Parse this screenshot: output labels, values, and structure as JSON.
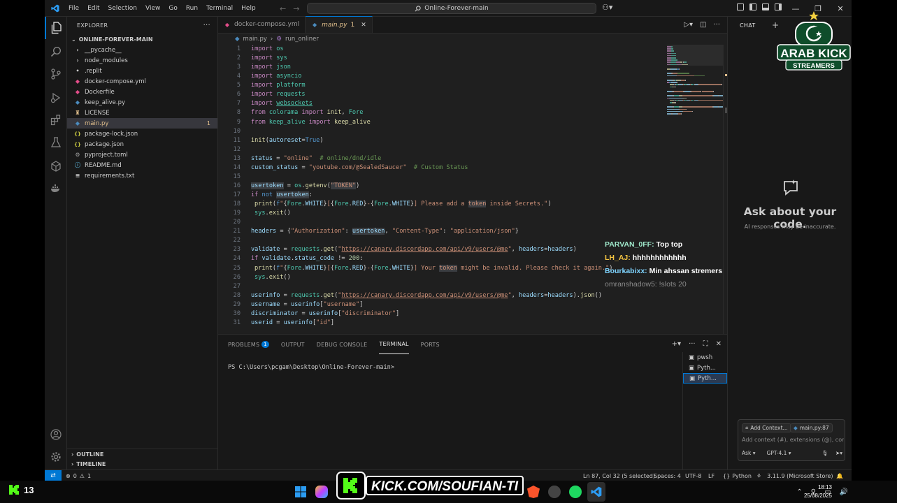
{
  "titlebar": {
    "menus": [
      "File",
      "Edit",
      "Selection",
      "View",
      "Go",
      "Run",
      "Terminal",
      "Help"
    ],
    "search": "Online-Forever-main"
  },
  "explorer": {
    "header": "EXPLORER",
    "folder": "ONLINE-FOREVER-MAIN",
    "items": [
      {
        "name": "__pycache__",
        "type": "folder"
      },
      {
        "name": "node_modules",
        "type": "folder"
      },
      {
        "name": ".replit",
        "type": "file"
      },
      {
        "name": "docker-compose.yml",
        "type": "docker"
      },
      {
        "name": "Dockerfile",
        "type": "docker"
      },
      {
        "name": "keep_alive.py",
        "type": "python"
      },
      {
        "name": "LICENSE",
        "type": "license"
      },
      {
        "name": "main.py",
        "type": "python",
        "badge": "1"
      },
      {
        "name": "package-lock.json",
        "type": "json"
      },
      {
        "name": "package.json",
        "type": "json"
      },
      {
        "name": "pyproject.toml",
        "type": "gear"
      },
      {
        "name": "README.md",
        "type": "info"
      },
      {
        "name": "requirements.txt",
        "type": "text"
      }
    ],
    "outline": "OUTLINE",
    "timeline": "TIMELINE"
  },
  "editor": {
    "tabs": [
      {
        "label": "docker-compose.yml",
        "active": false
      },
      {
        "label": "main.py",
        "active": true,
        "problems": "1"
      }
    ],
    "breadcrumb": [
      "main.py",
      "run_onliner"
    ]
  },
  "code": [
    {
      "n": "1",
      "t": [
        [
          "k",
          "import "
        ],
        [
          "m",
          "os"
        ]
      ]
    },
    {
      "n": "2",
      "t": [
        [
          "k",
          "import "
        ],
        [
          "m",
          "sys"
        ]
      ]
    },
    {
      "n": "3",
      "t": [
        [
          "k",
          "import "
        ],
        [
          "m",
          "json"
        ]
      ]
    },
    {
      "n": "4",
      "t": [
        [
          "k",
          "import "
        ],
        [
          "m",
          "asyncio"
        ]
      ]
    },
    {
      "n": "5",
      "t": [
        [
          "k",
          "import "
        ],
        [
          "m",
          "platform"
        ]
      ]
    },
    {
      "n": "6",
      "t": [
        [
          "k",
          "import "
        ],
        [
          "m",
          "requests"
        ]
      ]
    },
    {
      "n": "7",
      "t": [
        [
          "k",
          "import "
        ],
        [
          "m ul",
          "websockets"
        ]
      ]
    },
    {
      "n": "8",
      "t": [
        [
          "k",
          "from "
        ],
        [
          "m",
          "colorama "
        ],
        [
          "k",
          "import "
        ],
        [
          "f",
          "init"
        ],
        [
          "o",
          ", "
        ],
        [
          "m",
          "Fore"
        ]
      ]
    },
    {
      "n": "9",
      "t": [
        [
          "k",
          "from "
        ],
        [
          "m",
          "keep_alive "
        ],
        [
          "k",
          "import "
        ],
        [
          "f",
          "keep_alive"
        ]
      ]
    },
    {
      "n": "10",
      "t": []
    },
    {
      "n": "11",
      "t": [
        [
          "f",
          "init"
        ],
        [
          "o",
          "("
        ],
        [
          "v",
          "autoreset"
        ],
        [
          "o",
          "="
        ],
        [
          "bc",
          "True"
        ],
        [
          "o",
          ")"
        ]
      ]
    },
    {
      "n": "12",
      "t": []
    },
    {
      "n": "13",
      "t": [
        [
          "v",
          "status "
        ],
        [
          "o",
          "= "
        ],
        [
          "s",
          "\"online\""
        ],
        [
          "c",
          "  # online/dnd/idle"
        ]
      ]
    },
    {
      "n": "14",
      "t": [
        [
          "v",
          "custom_status "
        ],
        [
          "o",
          "= "
        ],
        [
          "s",
          "\"youtube.com/@SealedSaucer\""
        ],
        [
          "c",
          "  # Custom Status"
        ]
      ]
    },
    {
      "n": "15",
      "t": []
    },
    {
      "n": "16",
      "t": [
        [
          "v hl",
          "usertoken"
        ],
        [
          "o",
          " = "
        ],
        [
          "m",
          "os"
        ],
        [
          "o",
          "."
        ],
        [
          "f",
          "getenv"
        ],
        [
          "o",
          "("
        ],
        [
          "s hl",
          "\"TOKEN\""
        ],
        [
          "o",
          ")"
        ]
      ]
    },
    {
      "n": "17",
      "t": [
        [
          "k",
          "if "
        ],
        [
          "bc",
          "not "
        ],
        [
          "v hl",
          "usertoken"
        ],
        [
          "o",
          ":"
        ]
      ]
    },
    {
      "n": "18",
      "ind": true,
      "t": [
        [
          "f",
          "print"
        ],
        [
          "o",
          "("
        ],
        [
          "bc",
          "f"
        ],
        [
          "s",
          "\""
        ],
        [
          "o",
          "{"
        ],
        [
          "m",
          "Fore"
        ],
        [
          "o",
          "."
        ],
        [
          "v",
          "WHITE"
        ],
        [
          "o",
          "}"
        ],
        [
          "s",
          "["
        ],
        [
          "o",
          "{"
        ],
        [
          "m",
          "Fore"
        ],
        [
          "o",
          "."
        ],
        [
          "v",
          "RED"
        ],
        [
          "o",
          "}"
        ],
        [
          "s",
          "-"
        ],
        [
          "o",
          "{"
        ],
        [
          "m",
          "Fore"
        ],
        [
          "o",
          "."
        ],
        [
          "v",
          "WHITE"
        ],
        [
          "o",
          "}"
        ],
        [
          "s",
          "] Please add a "
        ],
        [
          "s hl",
          "token"
        ],
        [
          "s",
          " inside Secrets.\""
        ],
        [
          "o",
          ")"
        ]
      ]
    },
    {
      "n": "19",
      "ind": true,
      "t": [
        [
          "m",
          "sys"
        ],
        [
          "o",
          "."
        ],
        [
          "f",
          "exit"
        ],
        [
          "o",
          "()"
        ]
      ]
    },
    {
      "n": "20",
      "t": []
    },
    {
      "n": "21",
      "t": [
        [
          "v",
          "headers "
        ],
        [
          "o",
          "= {"
        ],
        [
          "s",
          "\"Authorization\""
        ],
        [
          "o",
          ": "
        ],
        [
          "v hl",
          "usertoken"
        ],
        [
          "o",
          ", "
        ],
        [
          "s",
          "\"Content-Type\""
        ],
        [
          "o",
          ": "
        ],
        [
          "s",
          "\"application/json\""
        ],
        [
          "o",
          "}"
        ]
      ]
    },
    {
      "n": "22",
      "t": []
    },
    {
      "n": "23",
      "t": [
        [
          "v",
          "validate "
        ],
        [
          "o",
          "= "
        ],
        [
          "m",
          "requests"
        ],
        [
          "o",
          "."
        ],
        [
          "f",
          "get"
        ],
        [
          "o",
          "("
        ],
        [
          "s",
          "\""
        ],
        [
          "s ul",
          "https://canary.discordapp.com/api/v9/users/@me"
        ],
        [
          "s",
          "\""
        ],
        [
          "o",
          ", "
        ],
        [
          "v",
          "headers"
        ],
        [
          "o",
          "="
        ],
        [
          "v",
          "headers"
        ],
        [
          "o",
          ")"
        ]
      ]
    },
    {
      "n": "24",
      "t": [
        [
          "k",
          "if "
        ],
        [
          "v",
          "validate"
        ],
        [
          "o",
          "."
        ],
        [
          "v",
          "status_code "
        ],
        [
          "o",
          "!= "
        ],
        [
          "n",
          "200"
        ],
        [
          "o",
          ":"
        ]
      ]
    },
    {
      "n": "25",
      "ind": true,
      "t": [
        [
          "f",
          "print"
        ],
        [
          "o",
          "("
        ],
        [
          "bc",
          "f"
        ],
        [
          "s",
          "\""
        ],
        [
          "o",
          "{"
        ],
        [
          "m",
          "Fore"
        ],
        [
          "o",
          "."
        ],
        [
          "v",
          "WHITE"
        ],
        [
          "o",
          "}"
        ],
        [
          "s",
          "["
        ],
        [
          "o",
          "{"
        ],
        [
          "m",
          "Fore"
        ],
        [
          "o",
          "."
        ],
        [
          "v",
          "RED"
        ],
        [
          "o",
          "}"
        ],
        [
          "s",
          "-"
        ],
        [
          "o",
          "{"
        ],
        [
          "m",
          "Fore"
        ],
        [
          "o",
          "."
        ],
        [
          "v",
          "WHITE"
        ],
        [
          "o",
          "}"
        ],
        [
          "s",
          "] Your "
        ],
        [
          "s hl",
          "token"
        ],
        [
          "s",
          " might be invalid. Please check it again.\""
        ],
        [
          "o",
          ")"
        ]
      ]
    },
    {
      "n": "26",
      "ind": true,
      "t": [
        [
          "m",
          "sys"
        ],
        [
          "o",
          "."
        ],
        [
          "f",
          "exit"
        ],
        [
          "o",
          "()"
        ]
      ]
    },
    {
      "n": "27",
      "t": []
    },
    {
      "n": "28",
      "t": [
        [
          "v",
          "userinfo "
        ],
        [
          "o",
          "= "
        ],
        [
          "m",
          "requests"
        ],
        [
          "o",
          "."
        ],
        [
          "f",
          "get"
        ],
        [
          "o",
          "("
        ],
        [
          "s",
          "\""
        ],
        [
          "s ul",
          "https://canary.discordapp.com/api/v9/users/@me"
        ],
        [
          "s",
          "\""
        ],
        [
          "o",
          ", "
        ],
        [
          "v",
          "headers"
        ],
        [
          "o",
          "="
        ],
        [
          "v",
          "headers"
        ],
        [
          "o",
          ")."
        ],
        [
          "f",
          "json"
        ],
        [
          "o",
          "()"
        ]
      ]
    },
    {
      "n": "29",
      "t": [
        [
          "v",
          "username "
        ],
        [
          "o",
          "= "
        ],
        [
          "v",
          "userinfo"
        ],
        [
          "o",
          "["
        ],
        [
          "s",
          "\"username\""
        ],
        [
          "o",
          "]"
        ]
      ]
    },
    {
      "n": "30",
      "t": [
        [
          "v",
          "discriminator "
        ],
        [
          "o",
          "= "
        ],
        [
          "v",
          "userinfo"
        ],
        [
          "o",
          "["
        ],
        [
          "s",
          "\"discriminator\""
        ],
        [
          "o",
          "]"
        ]
      ]
    },
    {
      "n": "31",
      "t": [
        [
          "v",
          "userid "
        ],
        [
          "o",
          "= "
        ],
        [
          "v",
          "userinfo"
        ],
        [
          "o",
          "["
        ],
        [
          "s",
          "\"id\""
        ],
        [
          "o",
          "]"
        ]
      ]
    }
  ],
  "panel": {
    "tabs": [
      {
        "label": "PROBLEMS",
        "badge": "1",
        "active": false
      },
      {
        "label": "OUTPUT",
        "active": false
      },
      {
        "label": "DEBUG CONSOLE",
        "active": false
      },
      {
        "label": "TERMINAL",
        "active": true
      },
      {
        "label": "PORTS",
        "active": false
      }
    ],
    "terminal_prompt": "PS C:\\Users\\pcgam\\Desktop\\Online-Forever-main>",
    "terminals": [
      {
        "label": "pwsh",
        "active": false
      },
      {
        "label": "Pyth...",
        "active": false
      },
      {
        "label": "Pyth...",
        "active": true
      }
    ]
  },
  "chat": {
    "header": "CHAT",
    "title": "Ask about your code.",
    "subtitle": "AI responses may be inaccurate.",
    "add_context": "Add Context...",
    "file_chip": "main.py:87",
    "placeholder": "Add context (#), extensions (@), commands",
    "mode": "Ask",
    "model": "GPT-4.1"
  },
  "statusbar": {
    "errors": "0",
    "warnings": "1",
    "position": "Ln 87, Col 32 (5 selected)",
    "spaces": "Spaces: 4",
    "encoding": "UTF-8",
    "eol": "LF",
    "language": "Python",
    "interpreter": "3.11.9 (Microsoft Store)"
  },
  "stream_chat": [
    {
      "user": "PARVAN_0FF:",
      "text": "Top top",
      "color": "#9ee6c9"
    },
    {
      "user": "LH_AJ:",
      "text": "hhhhhhhhhhhh",
      "color": "#f5c542"
    },
    {
      "user": "Bourkabixx:",
      "text": "Min ahssan stremers",
      "color": "#7fd4ff"
    },
    {
      "user": "omranshadow5:",
      "text": "!slots 20",
      "color": "#8a8a8a"
    }
  ],
  "overlay": {
    "logo_line1": "ARAB KICK",
    "logo_line2": "STREAMERS",
    "kick_url": "KICK.COM/SOUFIAN-TI",
    "viewer_count": "13"
  },
  "taskbar": {
    "time": "18:13",
    "date": "25/08/2025"
  },
  "colors": {
    "accent": "#0078d4",
    "kick_green": "#53fc18"
  }
}
